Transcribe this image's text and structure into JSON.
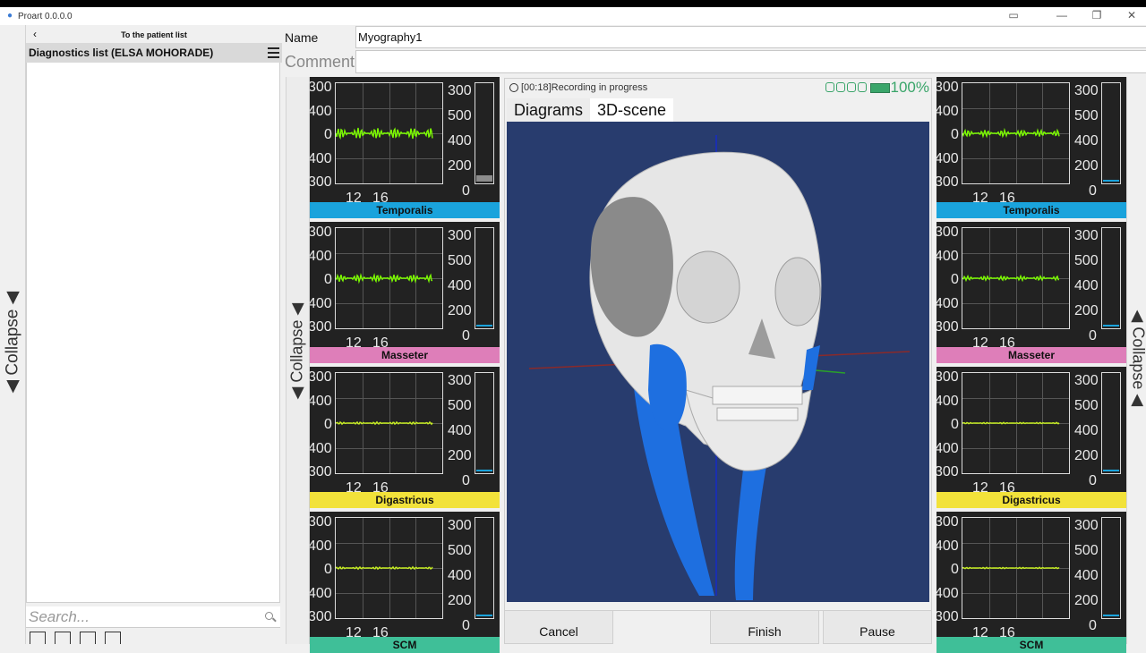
{
  "window": {
    "title": "Proart 0.0.0.0"
  },
  "left_panel": {
    "back_label": "To the patient list",
    "list_header": "Diagnostics list (ELSA MOHORADE)",
    "search_placeholder": "Search...",
    "collapse_label": "Collapse"
  },
  "form": {
    "name_label": "Name",
    "name_value": "Myography1",
    "comment_label": "Comment",
    "comment_value": ""
  },
  "center": {
    "collapse_label": "Collapse",
    "status_time": "[00:18]",
    "status_text": "Recording in progress",
    "battery_percent": "100%",
    "tabs": [
      "Diagrams",
      "3D-scene"
    ],
    "active_tab": "3D-scene",
    "buttons": {
      "cancel": "Cancel",
      "finish": "Finish",
      "pause": "Pause"
    }
  },
  "right_panel": {
    "collapse_label": "Collapse"
  },
  "muscles": [
    {
      "name": "Temporalis",
      "color": "#1aa3dc"
    },
    {
      "name": "Masseter",
      "color": "#de7eb9"
    },
    {
      "name": "Digastricus",
      "color": "#f2e23a"
    },
    {
      "name": "SCM",
      "color": "#3fbf98"
    }
  ],
  "axis_ticks": {
    "left_y": [
      "300",
      "400",
      "0",
      "400",
      "300"
    ],
    "bar_y": [
      "300",
      "500",
      "400",
      "200",
      "0"
    ],
    "x": [
      "12",
      "16"
    ]
  },
  "colors": {
    "signal": "#7cfc00",
    "scene_bg": "#283c6e",
    "bone": "#e8e8e8",
    "muscle_blue": "#1e6fe0"
  }
}
